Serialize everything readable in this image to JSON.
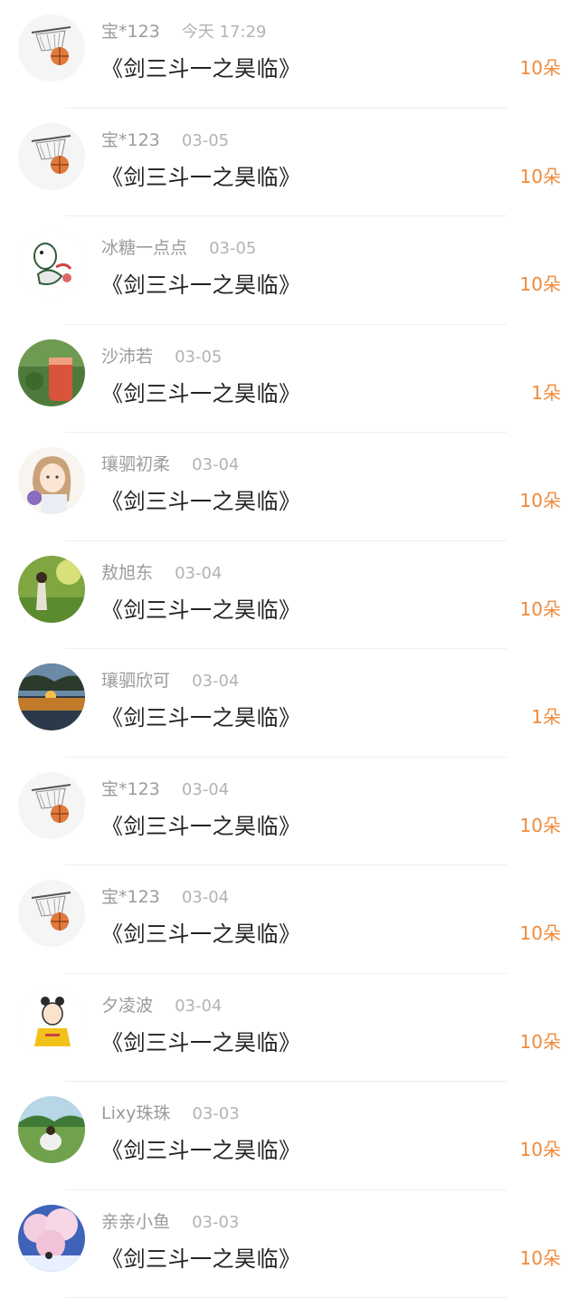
{
  "gift_items": [
    {
      "name": "宝*123",
      "time": "今天 17:29",
      "title": "《剑三斗一之昊临》",
      "gift": "10朵",
      "avatar_icon": "basketball-hoop-avatar"
    },
    {
      "name": "宝*123",
      "time": "03-05",
      "title": "《剑三斗一之昊临》",
      "gift": "10朵",
      "avatar_icon": "basketball-hoop-avatar"
    },
    {
      "name": "冰糖一点点",
      "time": "03-05",
      "title": "《剑三斗一之昊临》",
      "gift": "10朵",
      "avatar_icon": "cartoon-duck-avatar"
    },
    {
      "name": "沙沛若",
      "time": "03-05",
      "title": "《剑三斗一之昊临》",
      "gift": "1朵",
      "avatar_icon": "smoothie-photo-avatar"
    },
    {
      "name": "瓖驷初柔",
      "time": "03-04",
      "title": "《剑三斗一之昊临》",
      "gift": "10朵",
      "avatar_icon": "anime-girl-avatar"
    },
    {
      "name": "敖旭东",
      "time": "03-04",
      "title": "《剑三斗一之昊临》",
      "gift": "10朵",
      "avatar_icon": "nature-photo-avatar"
    },
    {
      "name": "瓖驷欣可",
      "time": "03-04",
      "title": "《剑三斗一之昊临》",
      "gift": "1朵",
      "avatar_icon": "sunset-lake-avatar"
    },
    {
      "name": "宝*123",
      "time": "03-04",
      "title": "《剑三斗一之昊临》",
      "gift": "10朵",
      "avatar_icon": "basketball-hoop-avatar"
    },
    {
      "name": "宝*123",
      "time": "03-04",
      "title": "《剑三斗一之昊临》",
      "gift": "10朵",
      "avatar_icon": "basketball-hoop-avatar"
    },
    {
      "name": "夕凌波",
      "time": "03-04",
      "title": "《剑三斗一之昊临》",
      "gift": "10朵",
      "avatar_icon": "cartoon-girl-avatar"
    },
    {
      "name": "Lixy珠珠",
      "time": "03-03",
      "title": "《剑三斗一之昊临》",
      "gift": "10朵",
      "avatar_icon": "park-photo-avatar"
    },
    {
      "name": "亲亲小鱼",
      "time": "03-03",
      "title": "《剑三斗一之昊临》",
      "gift": "10朵",
      "avatar_icon": "cherry-blossom-avatar"
    }
  ],
  "colors": {
    "gift_accent": "#f08a3a",
    "meta_text": "#9b9b9b",
    "title_text": "#222222",
    "divider": "#eeeeee"
  }
}
